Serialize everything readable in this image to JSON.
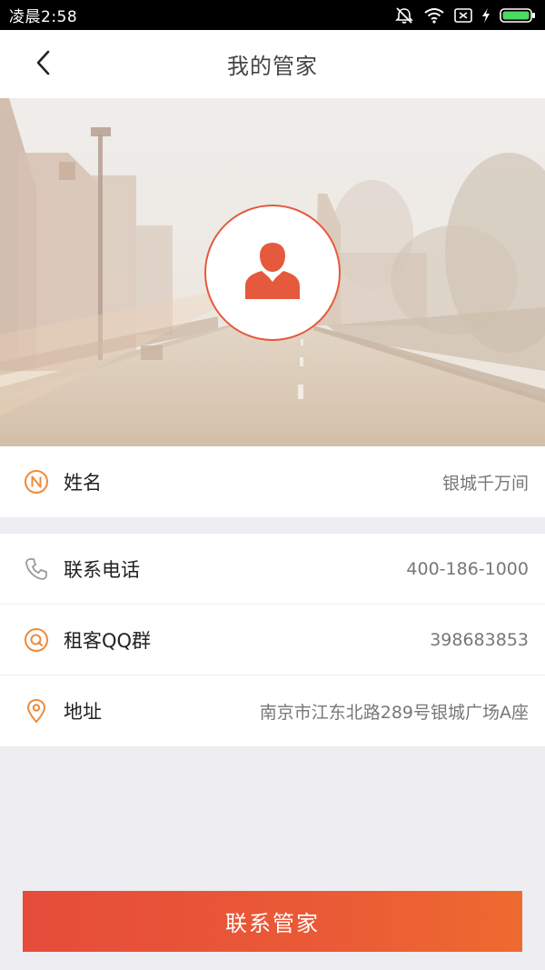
{
  "status_bar": {
    "time": "凌晨2:58",
    "icons": [
      "mute-icon",
      "wifi-icon",
      "sim-icon",
      "charging-icon",
      "battery-icon"
    ]
  },
  "nav": {
    "title": "我的管家",
    "back_icon": "chevron-left-icon"
  },
  "hero": {
    "avatar_icon": "person-icon",
    "accent": "#e55a3c"
  },
  "info_primary": [
    {
      "icon": "name-n-icon",
      "label": "姓名",
      "value": "银城千万间"
    }
  ],
  "info_contact": [
    {
      "icon": "phone-icon",
      "label": "联系电话",
      "value": "400-186-1000"
    },
    {
      "icon": "qq-icon",
      "label": "租客QQ群",
      "value": "398683853"
    },
    {
      "icon": "location-pin-icon",
      "label": "地址",
      "value": "南京市江东北路289号银城广场A座"
    }
  ],
  "footer": {
    "button_label": "联系管家",
    "button_color": "#e95637"
  }
}
